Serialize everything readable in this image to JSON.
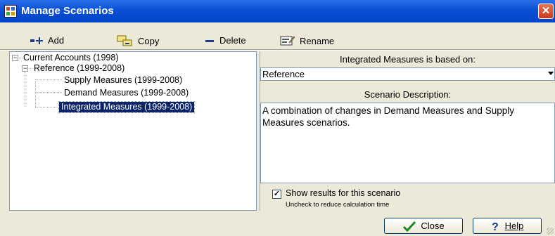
{
  "window": {
    "title": "Manage Scenarios",
    "close_glyph": "✕"
  },
  "toolbar": {
    "add_label": "Add",
    "copy_label": "Copy",
    "delete_label": "Delete",
    "rename_label": "Rename"
  },
  "tree": {
    "items": [
      {
        "label": "Current Accounts (1998)",
        "expander": "−"
      },
      {
        "label": "Reference (1999-2008)",
        "expander": "−"
      },
      {
        "label": "Supply Measures (1999-2008)"
      },
      {
        "label": "Demand Measures (1999-2008)"
      },
      {
        "label": "Integrated Measures (1999-2008)",
        "selected": true
      }
    ]
  },
  "based_on": {
    "label": "Integrated Measures is based on:",
    "value": "Reference"
  },
  "description": {
    "label": "Scenario Description:",
    "text": "A combination of changes in Demand Measures and Supply Measures scenarios."
  },
  "show_results": {
    "label": "Show results for this scenario",
    "hint": "Uncheck to reduce calculation time",
    "checked": true,
    "check_glyph": "✓"
  },
  "buttons": {
    "close_label": "Close",
    "help_label": "Help"
  },
  "icons": [
    "add-icon",
    "copy-icon",
    "delete-icon",
    "rename-icon",
    "check-icon",
    "help-icon",
    "close-icon",
    "app-icon"
  ],
  "colors": {
    "titlebar": "#0a4fd4",
    "selection": "#0a246a",
    "dialog_bg": "#ece9d8"
  }
}
